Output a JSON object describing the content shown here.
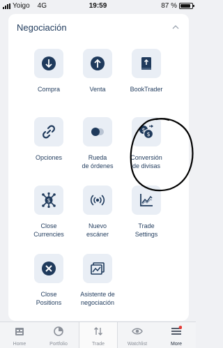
{
  "status_bar": {
    "carrier": "Yoigo",
    "network": "4G",
    "time": "19:59",
    "battery": "87 %",
    "battery_level": 0.87
  },
  "section": {
    "title": "Negociación"
  },
  "items": [
    {
      "label": "Compra",
      "icon": "arrow-down-circle-icon"
    },
    {
      "label": "Venta",
      "icon": "arrow-up-circle-icon"
    },
    {
      "label": "BookTrader",
      "icon": "book-icon"
    },
    {
      "label": "Opciones",
      "icon": "link-icon"
    },
    {
      "label": "Rueda de órdenes",
      "line1": "Rueda",
      "line2": "de órdenes",
      "icon": "toggle-icon"
    },
    {
      "label": "Conversión de divisas",
      "line1": "Conversión",
      "line2": "de divisas",
      "icon": "currency-exchange-icon"
    },
    {
      "label": "Close Currencies",
      "line1": "Close",
      "line2": "Currencies",
      "icon": "network-dollar-icon"
    },
    {
      "label": "Nuevo escáner",
      "line1": "Nuevo",
      "line2": "escáner",
      "icon": "scanner-icon"
    },
    {
      "label": "Trade Settings",
      "line1": "Trade",
      "line2": "Settings",
      "icon": "chart-icon"
    },
    {
      "label": "Close Positions",
      "line1": "Close",
      "line2": "Positions",
      "icon": "close-circle-icon"
    },
    {
      "label": "Asistente de negociación",
      "line1": "Asistente de",
      "line2": "negociación",
      "icon": "image-chart-icon"
    }
  ],
  "tabs": [
    {
      "label": "Home",
      "icon": "home-icon"
    },
    {
      "label": "Portfolio",
      "icon": "pie-chart-icon"
    },
    {
      "label": "Trade",
      "icon": "trade-arrows-icon"
    },
    {
      "label": "Watchlist",
      "icon": "eye-icon"
    },
    {
      "label": "More",
      "icon": "menu-icon"
    }
  ],
  "colors": {
    "accent": "#1f3a5c",
    "tile": "#e9eef5",
    "badge": "#e53935"
  }
}
